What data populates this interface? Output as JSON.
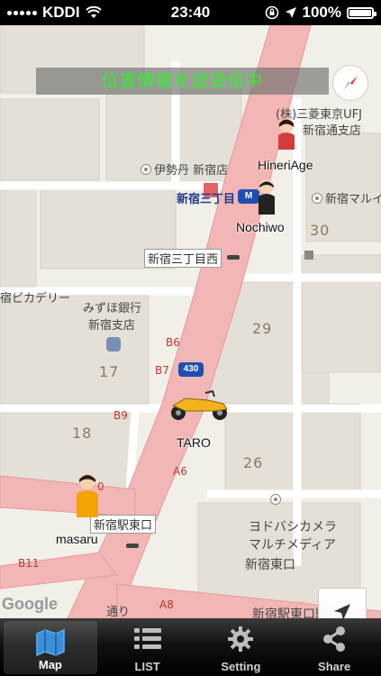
{
  "status_bar": {
    "carrier": "KDDI",
    "time": "23:40",
    "battery": "100%"
  },
  "banner": {
    "text": "位置情報を送受信中"
  },
  "map": {
    "labels": {
      "mufg": "(株)三菱東京UFJ",
      "mufg_branch": "新宿通支店",
      "isetan": "伊勢丹 新宿店",
      "station": "新宿三丁目",
      "marui": "新宿マルイ・",
      "nishi": "新宿三丁目西",
      "piccadilly": "宿ピカデリー",
      "mizuho": "みずほ銀行",
      "mizuho_branch": "新宿支店",
      "higashiguchi": "新宿駅東口",
      "yodobashi1": "ヨドバシカメラ",
      "yodobashi2": "マルチメディア",
      "yodobashi3": "新宿東口",
      "bottom": "新宿駅東口駐",
      "street": "通り",
      "google": "Google"
    },
    "block_numbers": {
      "b30": "30",
      "b29": "29",
      "b17": "17",
      "b18": "18",
      "b26": "26"
    },
    "road_codes": {
      "b6": "B6",
      "b7": "B7",
      "b9": "B9",
      "b11": "B11",
      "a6": "A6",
      "a8": "A8",
      "zero": "0"
    },
    "route_number": "430",
    "users": {
      "hineri": "HineriAge",
      "nochiwo": "Nochiwo",
      "taro": "TARO",
      "masaru": "masaru"
    }
  },
  "tabs": [
    {
      "label": "Map",
      "icon": "map-icon"
    },
    {
      "label": "LIST",
      "icon": "list-icon"
    },
    {
      "label": "Setting",
      "icon": "gear-icon"
    },
    {
      "label": "Share",
      "icon": "share-icon"
    }
  ],
  "colors": {
    "banner_text": "#2ef02a",
    "road": "#f2b6b6",
    "map_bg": "#f2efe9"
  }
}
